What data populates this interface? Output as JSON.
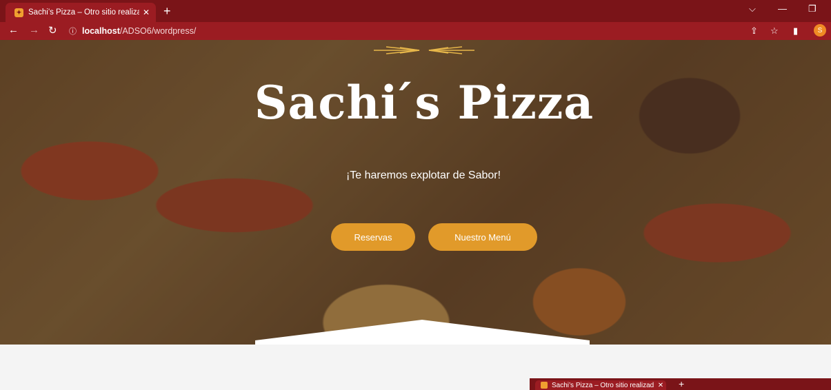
{
  "browser": {
    "tab_title": "Sachi’s Pizza – Otro sitio realizad",
    "tab_close": "✕",
    "new_tab": "+",
    "url_host": "localhost",
    "url_path": "/ADSO6/wordpress/",
    "avatar_letter": "S"
  },
  "hero": {
    "title": "Sachi ́s Pizza",
    "subtitle": "¡Te haremos explotar de Sabor!",
    "buttons": [
      "Reservas",
      "Nuestro Menú"
    ]
  },
  "colors": {
    "tabbar": "#7a1418",
    "addressbar": "#9b1c22",
    "button": "#e19a2a"
  },
  "mini_browser": {
    "tab_title": "Sachi’s Pizza – Otro sitio realizad",
    "tab_close": "✕",
    "new_tab": "+"
  }
}
